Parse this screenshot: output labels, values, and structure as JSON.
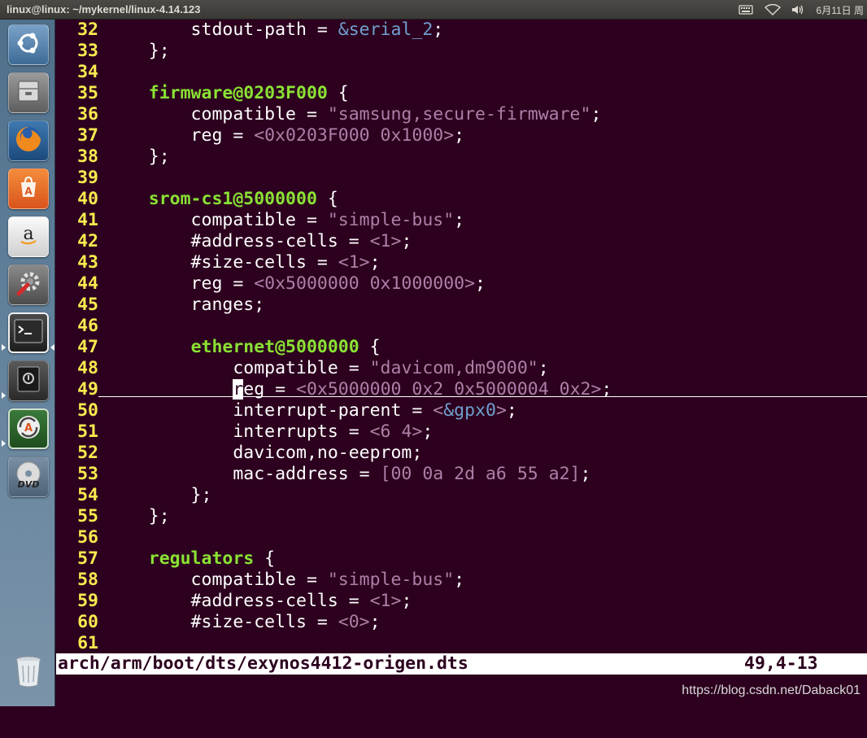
{
  "window": {
    "title": "linux@linux: ~/mykernel/linux-4.14.123"
  },
  "panel": {
    "clock": "6月11日 周"
  },
  "launcher": {
    "items": [
      {
        "name": "dash-home-icon",
        "tip": "Search"
      },
      {
        "name": "file-manager-icon",
        "tip": "Files"
      },
      {
        "name": "firefox-icon",
        "tip": "Firefox"
      },
      {
        "name": "software-center-icon",
        "tip": "Software"
      },
      {
        "name": "amazon-icon",
        "tip": "Amazon"
      },
      {
        "name": "system-settings-icon",
        "tip": "Settings"
      },
      {
        "name": "terminal-icon",
        "tip": "Terminal"
      },
      {
        "name": "safe-icon",
        "tip": "Safe"
      },
      {
        "name": "software-updater-icon",
        "tip": "Updater"
      },
      {
        "name": "dvd-icon",
        "tip": "DVD"
      },
      {
        "name": "trash-icon",
        "tip": "Trash"
      }
    ]
  },
  "editor": {
    "lines": [
      {
        "n": "32",
        "s": [
          [
            "        stdout-path = ",
            "txt"
          ],
          [
            "&serial_2",
            "ref"
          ],
          [
            ";",
            "txt"
          ]
        ]
      },
      {
        "n": "33",
        "s": [
          [
            "    };",
            "txt"
          ]
        ]
      },
      {
        "n": "34",
        "s": []
      },
      {
        "n": "35",
        "s": [
          [
            "    ",
            "txt"
          ],
          [
            "firmware@0203F000",
            "node"
          ],
          [
            " {",
            "txt"
          ]
        ]
      },
      {
        "n": "36",
        "s": [
          [
            "        compatible = ",
            "txt"
          ],
          [
            "\"samsung,secure-firmware\"",
            "str"
          ],
          [
            ";",
            "txt"
          ]
        ]
      },
      {
        "n": "37",
        "s": [
          [
            "        reg = ",
            "txt"
          ],
          [
            "<0x0203F000 0x1000>",
            "num"
          ],
          [
            ";",
            "txt"
          ]
        ]
      },
      {
        "n": "38",
        "s": [
          [
            "    };",
            "txt"
          ]
        ]
      },
      {
        "n": "39",
        "s": []
      },
      {
        "n": "40",
        "s": [
          [
            "    ",
            "txt"
          ],
          [
            "srom-cs1@5000000",
            "node"
          ],
          [
            " {",
            "txt"
          ]
        ]
      },
      {
        "n": "41",
        "s": [
          [
            "        compatible = ",
            "txt"
          ],
          [
            "\"simple-bus\"",
            "str"
          ],
          [
            ";",
            "txt"
          ]
        ]
      },
      {
        "n": "42",
        "s": [
          [
            "        #address-cells = ",
            "txt"
          ],
          [
            "<1>",
            "num"
          ],
          [
            ";",
            "txt"
          ]
        ]
      },
      {
        "n": "43",
        "s": [
          [
            "        #size-cells = ",
            "txt"
          ],
          [
            "<1>",
            "num"
          ],
          [
            ";",
            "txt"
          ]
        ]
      },
      {
        "n": "44",
        "s": [
          [
            "        reg = ",
            "txt"
          ],
          [
            "<0x5000000 0x1000000>",
            "num"
          ],
          [
            ";",
            "txt"
          ]
        ]
      },
      {
        "n": "45",
        "s": [
          [
            "        ranges;",
            "txt"
          ]
        ]
      },
      {
        "n": "46",
        "s": []
      },
      {
        "n": "47",
        "s": [
          [
            "        ",
            "txt"
          ],
          [
            "ethernet@5000000",
            "node"
          ],
          [
            " {",
            "txt"
          ]
        ]
      },
      {
        "n": "48",
        "s": [
          [
            "            compatible = ",
            "txt"
          ],
          [
            "\"davicom,dm9000\"",
            "str"
          ],
          [
            ";",
            "txt"
          ]
        ]
      },
      {
        "n": "49",
        "s": [
          [
            "            ",
            "txt"
          ],
          [
            "r",
            "cursor"
          ],
          [
            "eg = ",
            "txt"
          ],
          [
            "<0x5000000 0x2 0x5000004 0x2>",
            "num"
          ],
          [
            ";",
            "txt"
          ]
        ]
      },
      {
        "n": "50",
        "s": [
          [
            "            interrupt-parent = ",
            "txt"
          ],
          [
            "<",
            "num"
          ],
          [
            "&gpx0",
            "ref"
          ],
          [
            ">",
            "num"
          ],
          [
            ";",
            "txt"
          ]
        ]
      },
      {
        "n": "51",
        "s": [
          [
            "            interrupts = ",
            "txt"
          ],
          [
            "<6 4>",
            "num"
          ],
          [
            ";",
            "txt"
          ]
        ]
      },
      {
        "n": "52",
        "s": [
          [
            "            davicom,no-eeprom;",
            "txt"
          ]
        ]
      },
      {
        "n": "53",
        "s": [
          [
            "            mac-address = ",
            "txt"
          ],
          [
            "[00 0a 2d a6 55 a2]",
            "num"
          ],
          [
            ";",
            "txt"
          ]
        ]
      },
      {
        "n": "54",
        "s": [
          [
            "        };",
            "txt"
          ]
        ]
      },
      {
        "n": "55",
        "s": [
          [
            "    };",
            "txt"
          ]
        ]
      },
      {
        "n": "56",
        "s": []
      },
      {
        "n": "57",
        "s": [
          [
            "    ",
            "txt"
          ],
          [
            "regulators",
            "node"
          ],
          [
            " {",
            "txt"
          ]
        ]
      },
      {
        "n": "58",
        "s": [
          [
            "        compatible = ",
            "txt"
          ],
          [
            "\"simple-bus\"",
            "str"
          ],
          [
            ";",
            "txt"
          ]
        ]
      },
      {
        "n": "59",
        "s": [
          [
            "        #address-cells = ",
            "txt"
          ],
          [
            "<1>",
            "num"
          ],
          [
            ";",
            "txt"
          ]
        ]
      },
      {
        "n": "60",
        "s": [
          [
            "        #size-cells = ",
            "txt"
          ],
          [
            "<0>",
            "num"
          ],
          [
            ";",
            "txt"
          ]
        ]
      },
      {
        "n": "61",
        "s": []
      }
    ]
  },
  "status": {
    "file": "arch/arm/boot/dts/exynos4412-origen.dts",
    "position": "49,4-13"
  },
  "watermark": "https://blog.csdn.net/Daback01",
  "colors": {
    "background": "#2c001e",
    "line_number": "#fce94f",
    "node": "#8ae234",
    "string": "#ad7fa8",
    "reference": "#729fcf"
  }
}
